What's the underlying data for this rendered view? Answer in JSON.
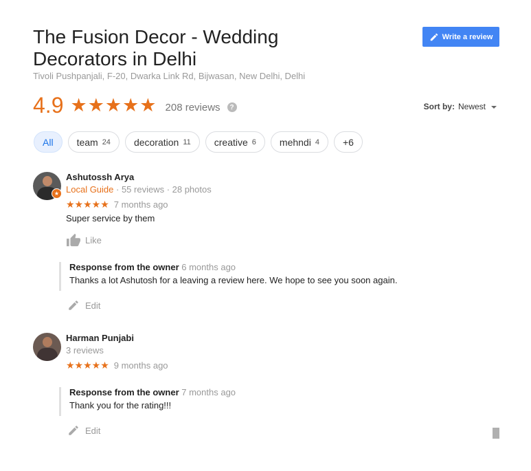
{
  "place": {
    "title": "The Fusion Decor - Wedding Decorators in Delhi",
    "address": "Tivoli Pushpanjali, F-20, Dwarka Link Rd, Bijwasan, New Delhi, Delhi"
  },
  "write_review_label": "Write a review",
  "summary": {
    "rating": "4.9",
    "stars": "★★★★★",
    "review_count": "208 reviews",
    "help_glyph": "?"
  },
  "sort": {
    "label": "Sort by:",
    "value": "Newest"
  },
  "chips": [
    {
      "label": "All",
      "count": "",
      "active": true
    },
    {
      "label": "team",
      "count": "24"
    },
    {
      "label": "decoration",
      "count": "11"
    },
    {
      "label": "creative",
      "count": "6"
    },
    {
      "label": "mehndi",
      "count": "4"
    },
    {
      "label": "+6",
      "count": ""
    }
  ],
  "reviews": [
    {
      "name": "Ashutossh Arya",
      "local_guide": "Local Guide",
      "meta": " · 55 reviews · 28 photos",
      "stars": "★★★★★",
      "rating": 5,
      "time": "7 months ago",
      "text": "Super service by them",
      "like_label": "Like",
      "response": {
        "title": "Response from the owner",
        "time": "6 months ago",
        "text": "Thanks a lot Ashutosh for a leaving a review here. We hope to see you soon again."
      },
      "edit_label": "Edit"
    },
    {
      "name": "Harman Punjabi",
      "meta": "3 reviews",
      "stars": "★★★★★",
      "rating": 5,
      "time": "9 months ago",
      "response": {
        "title": "Response from the owner",
        "time": "7 months ago",
        "text": "Thank you for the rating!!!"
      },
      "edit_label": "Edit"
    }
  ],
  "colors": {
    "accent": "#e7711b",
    "button": "#4285f4",
    "chip_active_bg": "#e8f0fe",
    "chip_active_text": "#1a73e8"
  }
}
